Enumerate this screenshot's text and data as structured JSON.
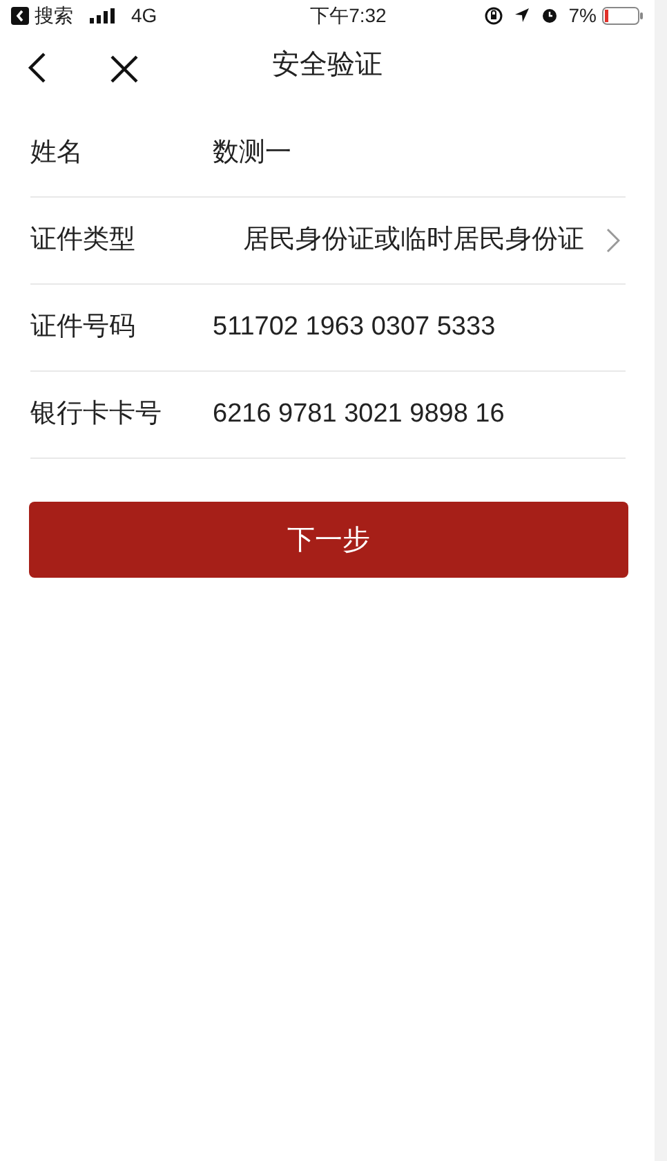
{
  "status_bar": {
    "back_app": "搜索",
    "network": "4G",
    "time": "下午7:32",
    "battery": "7%"
  },
  "header": {
    "title": "安全验证"
  },
  "rows": [
    {
      "kind": "text",
      "label": "姓名",
      "value": "数测一"
    },
    {
      "kind": "select",
      "label": "证件类型",
      "value": "居民身份证或临时居民身份证"
    },
    {
      "kind": "text",
      "label": "证件号码",
      "value": "511702 1963 0307 5333"
    },
    {
      "kind": "text",
      "label": "银行卡卡号",
      "value": "6216 9781 3021 9898 16"
    }
  ],
  "next_button": "下一步"
}
